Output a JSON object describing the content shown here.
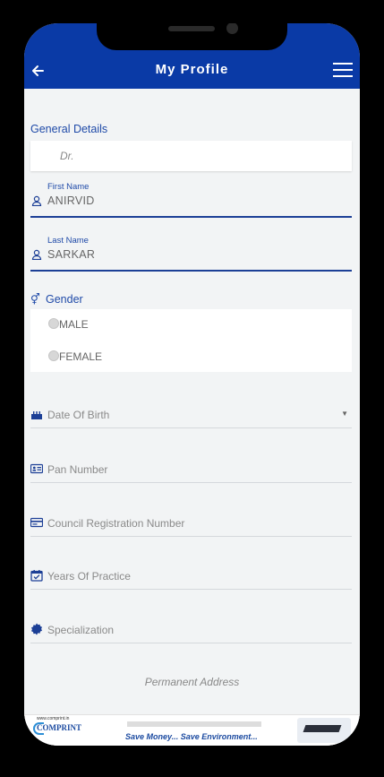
{
  "header": {
    "title": "My Profile",
    "back_icon": "arrow-left-icon",
    "menu_icon": "hamburger-icon"
  },
  "general": {
    "section_title": "General Details",
    "title_value": "Dr.",
    "first_name_label": "First Name",
    "first_name_value": "ANIRVID",
    "last_name_label": "Last Name",
    "last_name_value": "SARKAR"
  },
  "gender": {
    "label": "Gender",
    "options": [
      "MALE",
      "FEMALE"
    ]
  },
  "fields": {
    "dob": "Date Of Birth",
    "pan": "Pan Number",
    "council": "Council Registration Number",
    "practice": "Years Of Practice",
    "specialization": "Specialization"
  },
  "permanent_address": "Permanent Address",
  "ad": {
    "site": "www.comprint.in",
    "brand": "COMPRINT",
    "tagline": "Save Money... Save Environment..."
  },
  "colors": {
    "accent": "#0a3aa6",
    "label": "#1f4aa8"
  }
}
